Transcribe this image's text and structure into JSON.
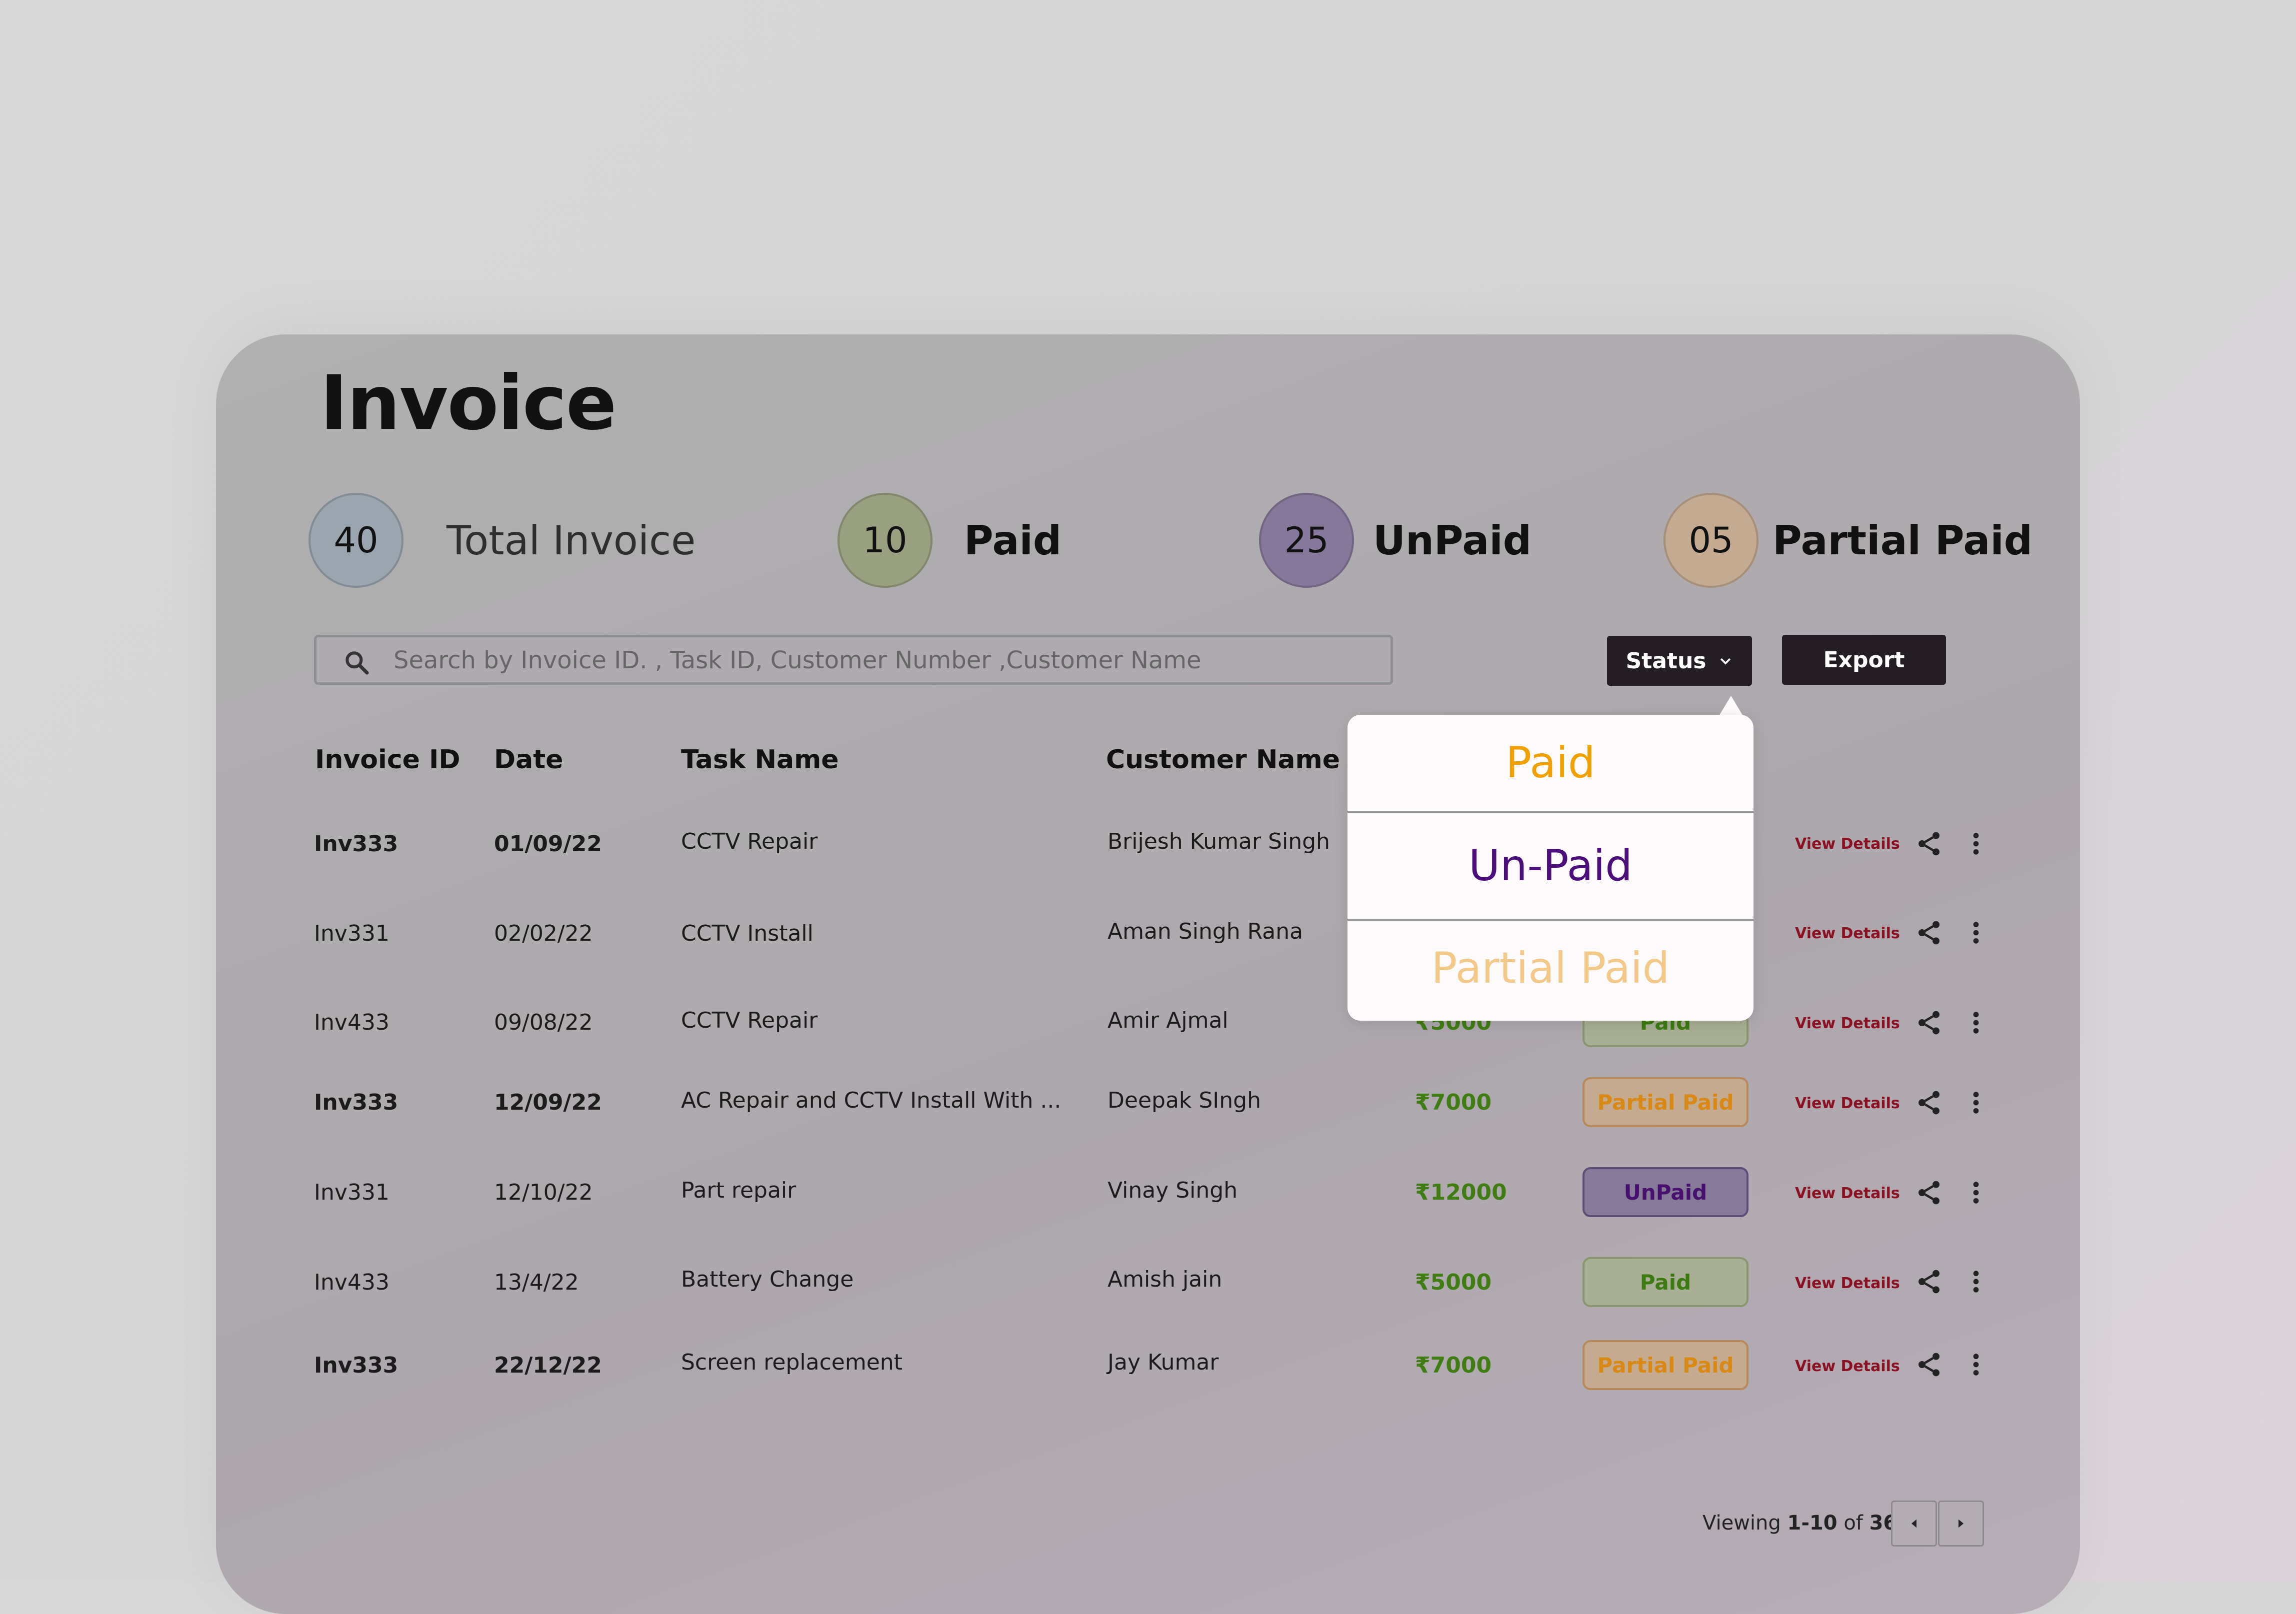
{
  "page": {
    "title": "Invoice"
  },
  "stats": [
    {
      "count": "40",
      "label": "Total Invoice",
      "color": "#9aa5b0"
    },
    {
      "count": "10",
      "label": "Paid",
      "color": "#98a080"
    },
    {
      "count": "25",
      "label": "UnPaid",
      "color": "#86789a"
    },
    {
      "count": "05",
      "label": "Partial Paid",
      "color": "#c3aa90"
    }
  ],
  "search": {
    "placeholder": "Search by Invoice ID. , Task ID, Customer Number ,Customer Name"
  },
  "toolbar": {
    "status_label": "Status",
    "export_label": "Export"
  },
  "table": {
    "columns": [
      "Invoice ID",
      "Date",
      "Task Name",
      "Customer Name"
    ],
    "view_label": "View Details",
    "rows": [
      {
        "id": "Inv333",
        "date": "01/09/22",
        "task": "CCTV Repair",
        "customer": "Brijesh Kumar Singh",
        "amount": "",
        "status": ""
      },
      {
        "id": "Inv331",
        "date": "02/02/22",
        "task": "CCTV Install",
        "customer": "Aman Singh Rana",
        "amount": "",
        "status": ""
      },
      {
        "id": "Inv433",
        "date": "09/08/22",
        "task": "CCTV Repair",
        "customer": "Amir Ajmal",
        "amount": "₹5000",
        "status": "Paid"
      },
      {
        "id": "Inv333",
        "date": "12/09/22",
        "task": "AC Repair and CCTV Install With ...",
        "customer": "Deepak SIngh",
        "amount": "₹7000",
        "status": "Partial Paid"
      },
      {
        "id": "Inv331",
        "date": "12/10/22",
        "task": "Part repair",
        "customer": "Vinay Singh",
        "amount": "₹12000",
        "status": "UnPaid"
      },
      {
        "id": "Inv433",
        "date": "13/4/22",
        "task": "Battery Change",
        "customer": "Amish jain",
        "amount": "₹5000",
        "status": "Paid"
      },
      {
        "id": "Inv333",
        "date": "22/12/22",
        "task": "Screen replacement",
        "customer": "Jay Kumar",
        "amount": "₹7000",
        "status": "Partial Paid"
      }
    ]
  },
  "status_dropdown": {
    "options": [
      {
        "label": "Paid",
        "color": "#f0a000"
      },
      {
        "label": "Un-Paid",
        "color": "#4b0e7a"
      },
      {
        "label": "Partial Paid",
        "color": "#f3c98a"
      }
    ]
  },
  "pagination": {
    "prefix": "Viewing ",
    "range": "1-10",
    "of": " of ",
    "total": "36"
  }
}
